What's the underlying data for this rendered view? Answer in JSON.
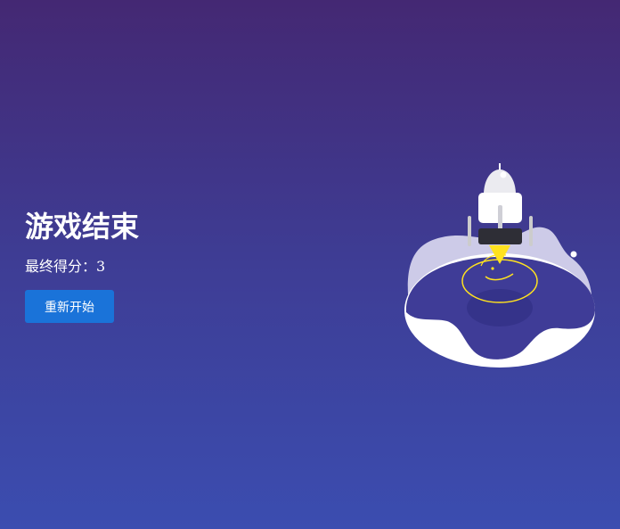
{
  "game_over": {
    "title": "游戏结束",
    "score_label": "最终得分：",
    "score_value": "3",
    "restart_label": "重新开始"
  },
  "scene": {
    "illustration": "rocket-landing-on-planet",
    "colors": {
      "background_top": "#442873",
      "background_bottom": "#3b4db0",
      "button": "#1a73d9",
      "ring": "#ffe21f"
    }
  }
}
